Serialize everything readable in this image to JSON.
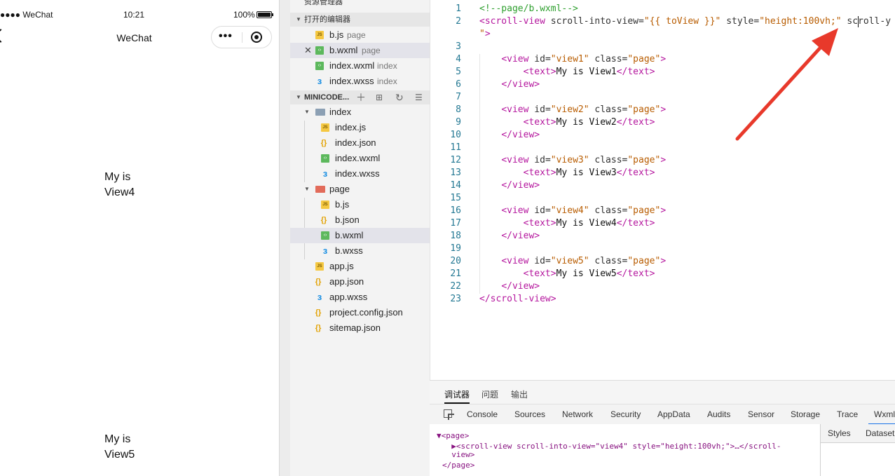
{
  "simulator": {
    "carrier": "●●●● WeChat",
    "time": "10:21",
    "battery_percent_text": "100%",
    "battery_level": 1.0,
    "nav_title": "WeChat",
    "views": [
      {
        "line1": "My is",
        "line2": "View4"
      },
      {
        "line1": "My is",
        "line2": "View5"
      }
    ]
  },
  "tree": {
    "top_section_label": "资源管理器",
    "open_editors_label": "打开的编辑器",
    "open_editors": [
      {
        "name": "b.js",
        "hint": "page",
        "icon": "js-file-icon"
      },
      {
        "name": "b.wxml",
        "hint": "page",
        "icon": "wxml-file-icon"
      },
      {
        "name": "index.wxml",
        "hint": "index",
        "icon": "wxml-file-icon"
      },
      {
        "name": "index.wxss",
        "hint": "index",
        "icon": "wxss-file-icon"
      }
    ],
    "project_label": "MINICODE...",
    "files": [
      {
        "name": "index",
        "icon": "folder-icon"
      },
      {
        "name": "index.js",
        "icon": "js-file-icon"
      },
      {
        "name": "index.json",
        "icon": "json-file-icon"
      },
      {
        "name": "index.wxml",
        "icon": "wxml-file-icon"
      },
      {
        "name": "index.wxss",
        "icon": "wxss-file-icon"
      },
      {
        "name": "page",
        "icon": "folder-icon"
      },
      {
        "name": "b.js",
        "icon": "js-file-icon"
      },
      {
        "name": "b.json",
        "icon": "json-file-icon"
      },
      {
        "name": "b.wxml",
        "icon": "wxml-file-icon"
      },
      {
        "name": "b.wxss",
        "icon": "wxss-file-icon"
      },
      {
        "name": "app.js",
        "icon": "js-file-icon"
      },
      {
        "name": "app.json",
        "icon": "json-file-icon"
      },
      {
        "name": "app.wxss",
        "icon": "wxss-file-icon"
      },
      {
        "name": "project.config.json",
        "icon": "json-file-icon"
      },
      {
        "name": "sitemap.json",
        "icon": "json-file-icon"
      }
    ]
  },
  "editor": {
    "line_numbers": [
      "1",
      "2",
      "",
      "3",
      "4",
      "5",
      "6",
      "7",
      "8",
      "9",
      "10",
      "11",
      "12",
      "13",
      "14",
      "15",
      "16",
      "17",
      "18",
      "19",
      "20",
      "21",
      "22",
      "23"
    ],
    "lines": [
      "<!--page/b.wxml-->",
      "<scroll-view scroll-into-view=\"{{ toView }}\" style=\"height:100vh;\" scroll-y",
      "\">",
      "",
      "    <view id=\"view1\" class=\"page\">",
      "        <text>My is View1</text>",
      "    </view>",
      "",
      "    <view id=\"view2\" class=\"page\">",
      "        <text>My is View2</text>",
      "    </view>",
      "",
      "    <view id=\"view3\" class=\"page\">",
      "        <text>My is View3</text>",
      "    </view>",
      "",
      "    <view id=\"view4\" class=\"page\">",
      "        <text>My is View4</text>",
      "    </view>",
      "",
      "    <view id=\"view5\" class=\"page\">",
      "        <text>My is View5</text>",
      "    </view>",
      "</scroll-view>"
    ]
  },
  "debug": {
    "panel_tabs": [
      "调试器",
      "问题",
      "输出"
    ],
    "devtools_tabs": [
      "Console",
      "Sources",
      "Network",
      "Security",
      "AppData",
      "Audits",
      "Sensor",
      "Storage",
      "Trace",
      "Wxml"
    ],
    "active_devtools_tab": "Wxml",
    "dom_lines": [
      "▼<page>",
      "  ▶<scroll-view scroll-into-view=\"view4\" style=\"height:100vh;\">…</scroll-",
      "  view>",
      "</page>"
    ],
    "side_tabs": [
      "Styles",
      "Dataset"
    ]
  },
  "annotation": {
    "color": "#e8392b"
  }
}
